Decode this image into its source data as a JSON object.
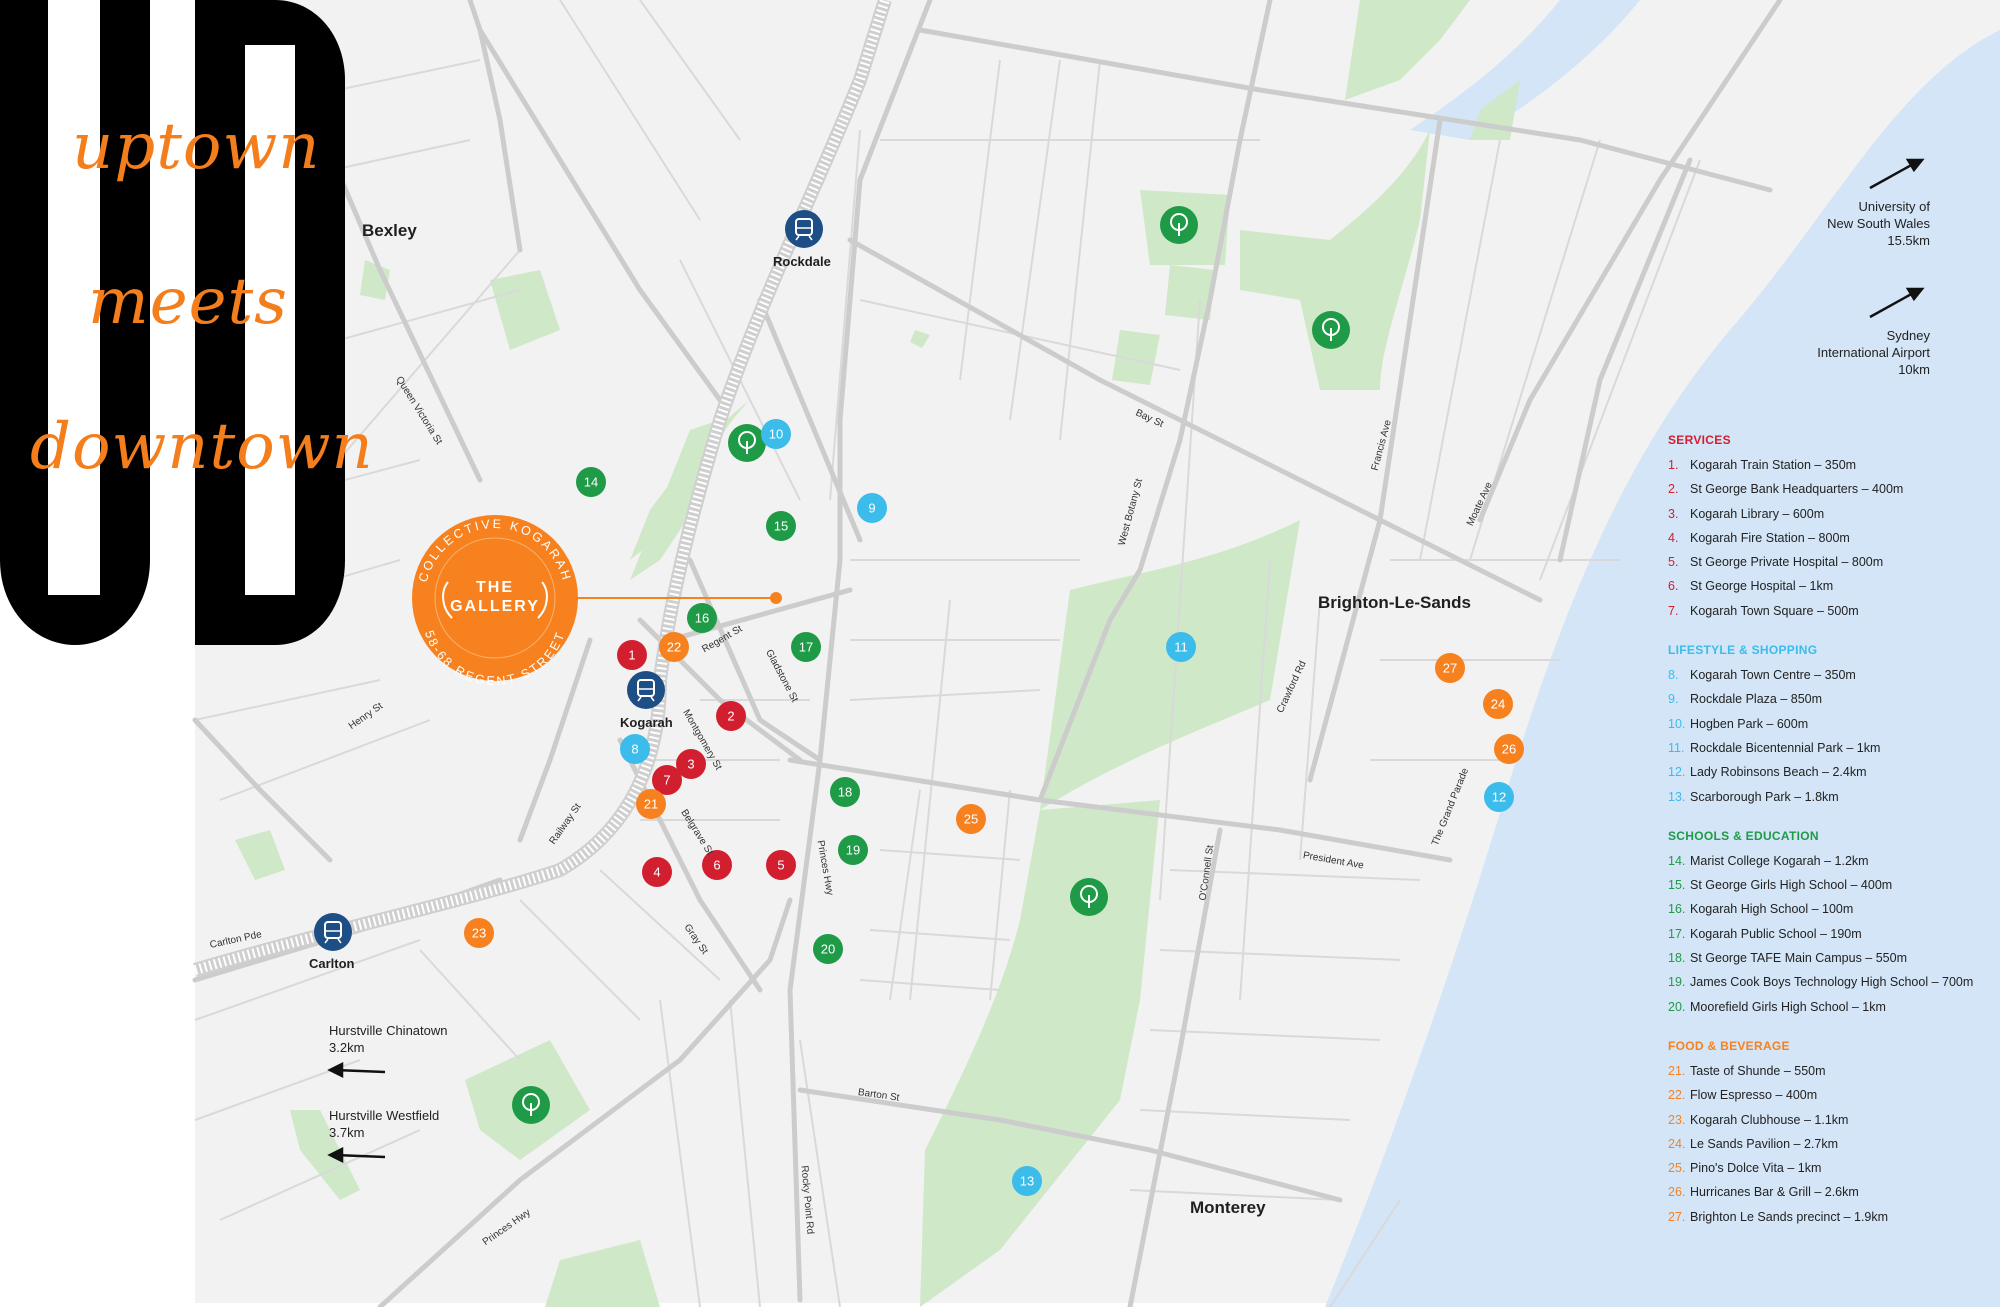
{
  "colors": {
    "services": "#d21f2f",
    "lifestyle": "#3bbcea",
    "schools": "#1f9a47",
    "food": "#f7811e",
    "station": "#1e4e86",
    "park": "#cfe8c8",
    "water": "#d3e5f6",
    "land": "#f2f2f2",
    "road": "#d2d2d2",
    "accent": "#f7811e"
  },
  "tagline": {
    "line1": "uptown",
    "line2": "meets",
    "line3": "downtown"
  },
  "stamp": {
    "ring_top": "COLLECTIVE KOGARAH",
    "ring_bottom": "58-68 REGENT STREET",
    "center_line1": "THE",
    "center_line2": "GALLERY"
  },
  "places": {
    "bexley": "Bexley",
    "brighton": "Brighton-Le-Sands",
    "monterey": "Monterey"
  },
  "stations": [
    {
      "name": "Rockdale",
      "icon": "train-icon"
    },
    {
      "name": "Kogarah",
      "icon": "train-icon"
    },
    {
      "name": "Carlton",
      "icon": "train-icon"
    }
  ],
  "streets": {
    "queen_victoria": "Queen Victoria St",
    "henry": "Henry St",
    "railway": "Railway St",
    "carlton_pde": "Carlton Pde",
    "regent": "Regent St",
    "gladstone": "Gladstone St",
    "montgomery": "Montgomery St",
    "belgrave": "Belgrave St",
    "gray": "Gray St",
    "princes_hwy_1": "Princes Hwy",
    "princes_hwy_2": "Princes Hwy",
    "bay": "Bay St",
    "west_botany": "West Botany St",
    "francis": "Francis Ave",
    "moate": "Moate Ave",
    "crawford": "Crawford Rd",
    "grand_parade": "The Grand Parade",
    "president": "President Ave",
    "oconnell": "O'Connell St",
    "barton": "Barton St",
    "rocky_point": "Rocky Point Rd"
  },
  "destinations": {
    "unsw": {
      "line1": "University of",
      "line2": "New South Wales",
      "line3": "15.5km"
    },
    "airport": {
      "line1": "Sydney",
      "line2": "International Airport",
      "line3": "10km"
    },
    "chinatown": {
      "line1": "Hurstville Chinatown",
      "line2": "3.2km"
    },
    "westfield": {
      "line1": "Hurstville Westfield",
      "line2": "3.7km"
    }
  },
  "park_icon": "tree-icon",
  "markers": [
    {
      "n": "1",
      "cat": "services"
    },
    {
      "n": "2",
      "cat": "services"
    },
    {
      "n": "3",
      "cat": "services"
    },
    {
      "n": "4",
      "cat": "services"
    },
    {
      "n": "5",
      "cat": "services"
    },
    {
      "n": "6",
      "cat": "services"
    },
    {
      "n": "7",
      "cat": "services"
    },
    {
      "n": "8",
      "cat": "lifestyle"
    },
    {
      "n": "9",
      "cat": "lifestyle"
    },
    {
      "n": "10",
      "cat": "lifestyle"
    },
    {
      "n": "11",
      "cat": "lifestyle"
    },
    {
      "n": "12",
      "cat": "lifestyle"
    },
    {
      "n": "13",
      "cat": "lifestyle"
    },
    {
      "n": "14",
      "cat": "schools"
    },
    {
      "n": "15",
      "cat": "schools"
    },
    {
      "n": "16",
      "cat": "schools"
    },
    {
      "n": "17",
      "cat": "schools"
    },
    {
      "n": "18",
      "cat": "schools"
    },
    {
      "n": "19",
      "cat": "schools"
    },
    {
      "n": "20",
      "cat": "schools"
    },
    {
      "n": "21",
      "cat": "food"
    },
    {
      "n": "22",
      "cat": "food"
    },
    {
      "n": "23",
      "cat": "food"
    },
    {
      "n": "24",
      "cat": "food"
    },
    {
      "n": "25",
      "cat": "food"
    },
    {
      "n": "26",
      "cat": "food"
    },
    {
      "n": "27",
      "cat": "food"
    }
  ],
  "legend": [
    {
      "title": "SERVICES",
      "cat": "services",
      "items": [
        {
          "n": "1.",
          "label": "Kogarah Train Station – 350m"
        },
        {
          "n": "2.",
          "label": "St George Bank Headquarters – 400m"
        },
        {
          "n": "3.",
          "label": "Kogarah Library – 600m"
        },
        {
          "n": "4.",
          "label": "Kogarah Fire Station – 800m"
        },
        {
          "n": "5.",
          "label": "St George Private Hospital – 800m"
        },
        {
          "n": "6.",
          "label": "St George Hospital – 1km"
        },
        {
          "n": "7.",
          "label": "Kogarah Town Square – 500m"
        }
      ]
    },
    {
      "title": "LIFESTYLE & SHOPPING",
      "cat": "lifestyle",
      "items": [
        {
          "n": "8.",
          "label": "Kogarah Town Centre – 350m"
        },
        {
          "n": "9.",
          "label": "Rockdale Plaza – 850m"
        },
        {
          "n": "10.",
          "label": "Hogben Park – 600m"
        },
        {
          "n": "11.",
          "label": "Rockdale Bicentennial Park – 1km"
        },
        {
          "n": "12.",
          "label": "Lady Robinsons Beach – 2.4km"
        },
        {
          "n": "13.",
          "label": "Scarborough Park – 1.8km"
        }
      ]
    },
    {
      "title": "SCHOOLS & EDUCATION",
      "cat": "schools",
      "items": [
        {
          "n": "14.",
          "label": "Marist College Kogarah – 1.2km"
        },
        {
          "n": "15.",
          "label": "St George Girls High School – 400m"
        },
        {
          "n": "16.",
          "label": "Kogarah High School – 100m"
        },
        {
          "n": "17.",
          "label": "Kogarah Public School – 190m"
        },
        {
          "n": "18.",
          "label": "St George TAFE Main Campus – 550m"
        },
        {
          "n": "19.",
          "label": "James Cook Boys Technology High School – 700m"
        },
        {
          "n": "20.",
          "label": "Moorefield Girls High School – 1km"
        }
      ]
    },
    {
      "title": "FOOD & BEVERAGE",
      "cat": "food",
      "items": [
        {
          "n": "21.",
          "label": "Taste of Shunde – 550m"
        },
        {
          "n": "22.",
          "label": "Flow Espresso – 400m"
        },
        {
          "n": "23.",
          "label": "Kogarah Clubhouse – 1.1km"
        },
        {
          "n": "24.",
          "label": "Le Sands Pavilion – 2.7km"
        },
        {
          "n": "25.",
          "label": "Pino's Dolce Vita – 1km"
        },
        {
          "n": "26.",
          "label": "Hurricanes Bar & Grill – 2.6km"
        },
        {
          "n": "27.",
          "label": "Brighton Le Sands precinct – 1.9km"
        }
      ]
    }
  ]
}
